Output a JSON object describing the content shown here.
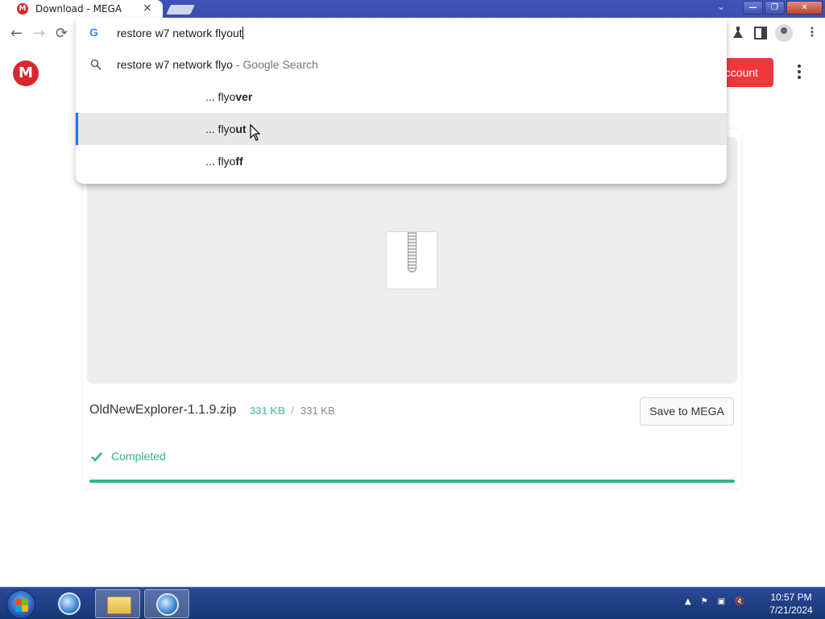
{
  "tab": {
    "title": "Download - MEGA",
    "favicon_letter": "M",
    "close": "×"
  },
  "window": {
    "minimize": "—",
    "restore": "❐",
    "close": "✕"
  },
  "toolbar": {
    "back": "←",
    "forward": "→",
    "reload": "⟳",
    "tab_search": "⌄",
    "menu": "⋮"
  },
  "omnibox": {
    "engine_icon": "G",
    "input_value": "restore w7 network flyout",
    "suggestions": [
      {
        "query": "restore w7 network flyo",
        "hint": " - Google Search"
      },
      {
        "prefix": "... flyo",
        "bold": "ver"
      },
      {
        "prefix": "... flyo",
        "bold": "ut"
      },
      {
        "prefix": "... flyo",
        "bold": "ff"
      }
    ],
    "selected_index": 2
  },
  "page": {
    "logo_letter": "M",
    "account_button": "account",
    "file": {
      "name": "OldNewExplorer-1.1.9.zip",
      "downloaded": "331 KB",
      "separator": "/",
      "total": "331 KB",
      "save_button": "Save to MEGA",
      "status": "Completed",
      "progress_fraction": 1.0
    }
  },
  "taskbar": {
    "clock_time": "10:57 PM",
    "clock_date": "7/21/2024",
    "tray": [
      "▲",
      "⚑",
      "▣",
      "🔇"
    ]
  },
  "colors": {
    "mega_red": "#d9272e",
    "success_green": "#31b48c",
    "taskbar_blue": "#1f3e85"
  }
}
